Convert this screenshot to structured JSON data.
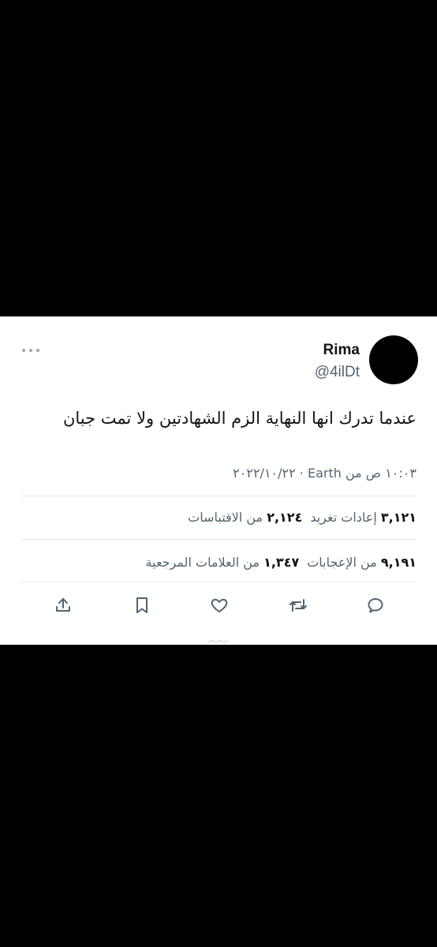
{
  "tweet": {
    "display_name": "Rima",
    "handle": "@4ilDt",
    "text": "عندما تدرك انها النهاية الزم الشهادتين ولا تمت جبان",
    "meta": "١٠:٠٣ ص من Earth · ٢٠٢٢/١٠/٢٢"
  },
  "stats": {
    "retweets_count": "٣,١٢١",
    "retweets_label": "إعادات تغريد",
    "quotes_count": "٢,١٢٤",
    "quotes_label": "من الاقتباسات",
    "likes_count": "٩,١٩١",
    "likes_label": "من الإعجابات",
    "bookmarks_count": "١,٣٤٧",
    "bookmarks_label": "من العلامات المرجعية"
  },
  "actions": {
    "icons": [
      "reply-icon",
      "retweet-icon",
      "like-icon",
      "bookmark-icon",
      "share-icon"
    ]
  },
  "colors": {
    "background": "#000000",
    "card": "#ffffff",
    "text_primary": "#0f1419",
    "text_secondary": "#536471",
    "divider": "#e6ebee"
  }
}
